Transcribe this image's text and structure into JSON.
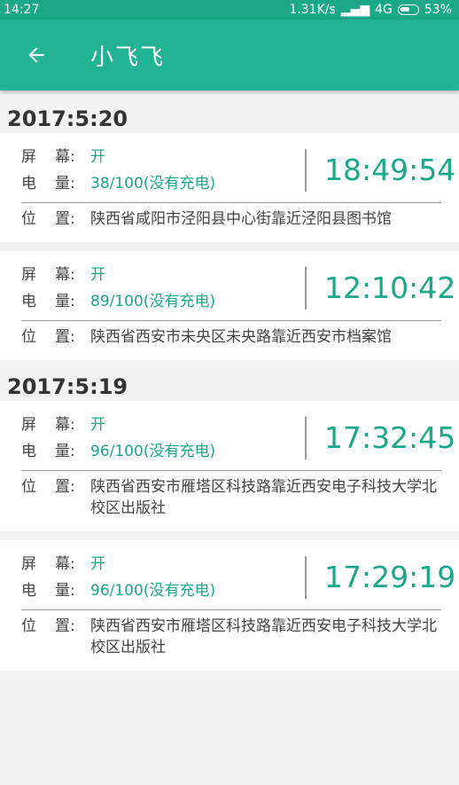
{
  "status": {
    "time": "14:27",
    "speed": "1.31K/s",
    "network": "4G",
    "battery": "53%"
  },
  "toolbar": {
    "title": "小飞飞"
  },
  "labels": {
    "screen_a": "屏",
    "screen_b": "幕:",
    "power_a": "电",
    "power_b": "量:",
    "loc_a": "位",
    "loc_b": "置:"
  },
  "groups": [
    {
      "date": "2017:5:20",
      "records": [
        {
          "screen": "开",
          "battery": "38/100(没有充电)",
          "time": "18:49:54",
          "location": "陕西省咸阳市泾阳县中心街靠近泾阳县图书馆"
        },
        {
          "screen": "开",
          "battery": "89/100(没有充电)",
          "time": "12:10:42",
          "location": "陕西省西安市未央区未央路靠近西安市档案馆"
        }
      ]
    },
    {
      "date": "2017:5:19",
      "records": [
        {
          "screen": "开",
          "battery": "96/100(没有充电)",
          "time": "17:32:45",
          "location": "陕西省西安市雁塔区科技路靠近西安电子科技大学北校区出版社"
        },
        {
          "screen": "开",
          "battery": "96/100(没有充电)",
          "time": "17:29:19",
          "location": "陕西省西安市雁塔区科技路靠近西安电子科技大学北校区出版社"
        }
      ]
    }
  ]
}
